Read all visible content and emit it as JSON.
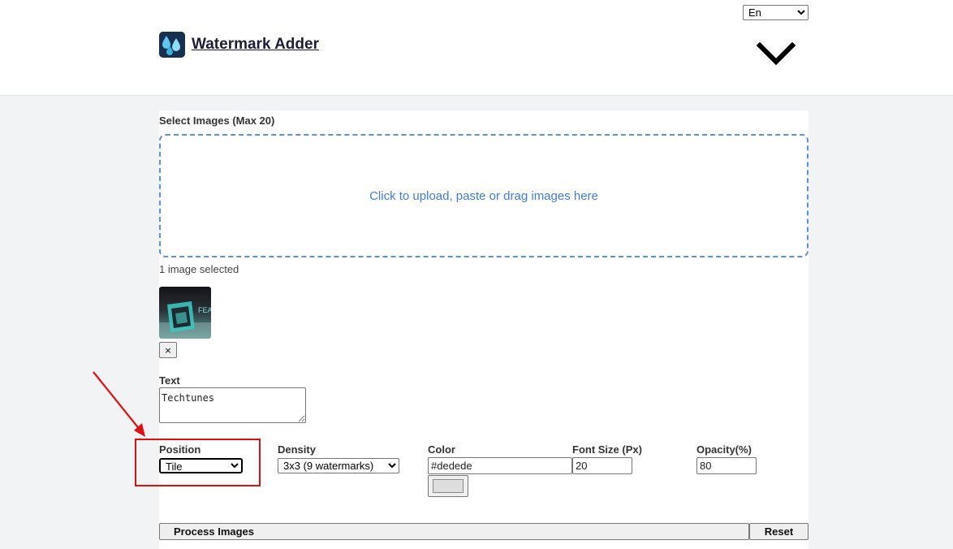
{
  "header": {
    "title": "Watermark Adder",
    "language": "En",
    "logo_icon": "droplet-logo-icon",
    "menu_icon": "chevron-down-icon"
  },
  "upload": {
    "label": "Select Images (Max 20)",
    "dropzone_text": "Click to upload, paste or drag images here",
    "selected_count": "1 image selected",
    "remove_label": "×",
    "thumbnail_text": "FEAT"
  },
  "text_field": {
    "label": "Text",
    "value": "Techtunes"
  },
  "position": {
    "label": "Position",
    "selected": "Tile"
  },
  "density": {
    "label": "Density",
    "selected": "3x3 (9 watermarks)"
  },
  "color": {
    "label": "Color",
    "value": "#dedede"
  },
  "font_size": {
    "label": "Font Size (Px)",
    "value": "20"
  },
  "opacity": {
    "label": "Opacity(%)",
    "value": "80"
  },
  "actions": {
    "process_label": "Process Images",
    "reset_label": "Reset"
  },
  "colors": {
    "accent": "#3f7be0",
    "annotation": "#e01010",
    "swatch": "#dedede"
  }
}
